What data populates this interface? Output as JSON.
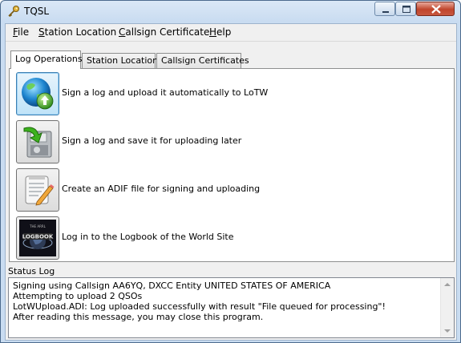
{
  "window": {
    "title": "TQSL"
  },
  "menu": [
    {
      "label": "File",
      "mnemonic": "F",
      "rest": "ile"
    },
    {
      "label": "Station Location",
      "mnemonic": "S",
      "rest": "tation Location"
    },
    {
      "label": "Callsign Certificate",
      "mnemonic": "C",
      "rest": "allsign Certificate"
    },
    {
      "label": "Help",
      "mnemonic": "H",
      "rest": "elp"
    }
  ],
  "tabs": [
    {
      "label": "Log Operations",
      "active": true
    },
    {
      "label": "Station Locations",
      "active": false
    },
    {
      "label": "Callsign Certificates",
      "active": false
    }
  ],
  "operations": [
    {
      "label": "Sign a log and upload it automatically to LoTW",
      "icon": "globe-upload-icon"
    },
    {
      "label": "Sign a log and save it for uploading later",
      "icon": "save-disk-icon"
    },
    {
      "label": "Create an ADIF file for signing and uploading",
      "icon": "edit-document-icon"
    },
    {
      "label": "Log in to the Logbook of the World Site",
      "icon": "lotw-logo-icon"
    }
  ],
  "status": {
    "label": "Status Log",
    "lines": [
      "Signing using Callsign AA6YQ, DXCC Entity UNITED STATES OF AMERICA",
      "Attempting to upload 2 QSOs",
      "LotWUpload.ADI: Log uploaded successfully with result \"File queued for processing\"!",
      "After reading this message, you may close this program."
    ]
  }
}
